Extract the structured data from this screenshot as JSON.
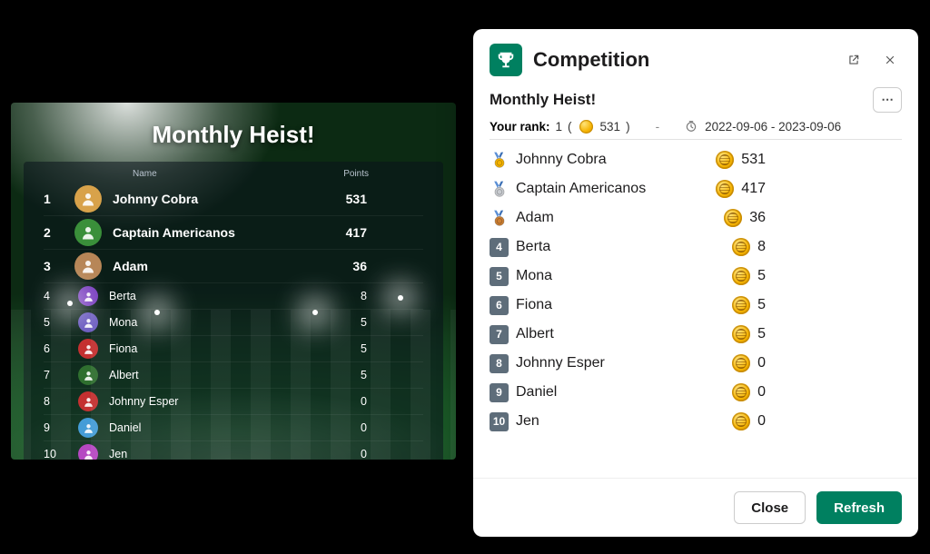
{
  "stadium": {
    "title": "Monthly Heist!",
    "headers": {
      "name": "Name",
      "points": "Points"
    },
    "rows": [
      {
        "rank": "1",
        "name": "Johnny Cobra",
        "points": "531",
        "top": true,
        "avatar_bg": "#d8a24a"
      },
      {
        "rank": "2",
        "name": "Captain Americanos",
        "points": "417",
        "top": true,
        "avatar_bg": "#3a8f3a"
      },
      {
        "rank": "3",
        "name": "Adam",
        "points": "36",
        "top": true,
        "avatar_bg": "#b78657"
      },
      {
        "rank": "4",
        "name": "Berta",
        "points": "8",
        "top": false,
        "avatar_bg": "#7a3fbf"
      },
      {
        "rank": "5",
        "name": "Mona",
        "points": "5",
        "top": false,
        "avatar_bg": "#6a5abf"
      },
      {
        "rank": "6",
        "name": "Fiona",
        "points": "5",
        "top": false,
        "avatar_bg": "#c43030"
      },
      {
        "rank": "7",
        "name": "Albert",
        "points": "5",
        "top": false,
        "avatar_bg": "#2f6f2f"
      },
      {
        "rank": "8",
        "name": "Johnny Esper",
        "points": "0",
        "top": false,
        "avatar_bg": "#c43030"
      },
      {
        "rank": "9",
        "name": "Daniel",
        "points": "0",
        "top": false,
        "avatar_bg": "#3f9ad6"
      },
      {
        "rank": "10",
        "name": "Jen",
        "points": "0",
        "top": false,
        "avatar_bg": "#b23fbf"
      }
    ]
  },
  "modal": {
    "title": "Competition",
    "subtitle": "Monthly Heist!",
    "meta": {
      "rank_label": "Your rank:",
      "rank_value": "1",
      "rank_points": "531",
      "sep": "-",
      "date_range": "2022-09-06 - 2023-09-06"
    },
    "rows": [
      {
        "rank": 1,
        "medal": "gold",
        "name": "Johnny Cobra",
        "points": "531"
      },
      {
        "rank": 2,
        "medal": "silver",
        "name": "Captain Americanos",
        "points": "417"
      },
      {
        "rank": 3,
        "medal": "bronze",
        "name": "Adam",
        "points": "36"
      },
      {
        "rank": 4,
        "tile": "4",
        "name": "Berta",
        "points": "8"
      },
      {
        "rank": 5,
        "tile": "5",
        "name": "Mona",
        "points": "5"
      },
      {
        "rank": 6,
        "tile": "6",
        "name": "Fiona",
        "points": "5"
      },
      {
        "rank": 7,
        "tile": "7",
        "name": "Albert",
        "points": "5"
      },
      {
        "rank": 8,
        "tile": "8",
        "name": "Johnny Esper",
        "points": "0"
      },
      {
        "rank": 9,
        "tile": "9",
        "name": "Daniel",
        "points": "0"
      },
      {
        "rank": 10,
        "tile": "10",
        "name": "Jen",
        "points": "0"
      }
    ],
    "buttons": {
      "close": "Close",
      "refresh": "Refresh"
    }
  }
}
